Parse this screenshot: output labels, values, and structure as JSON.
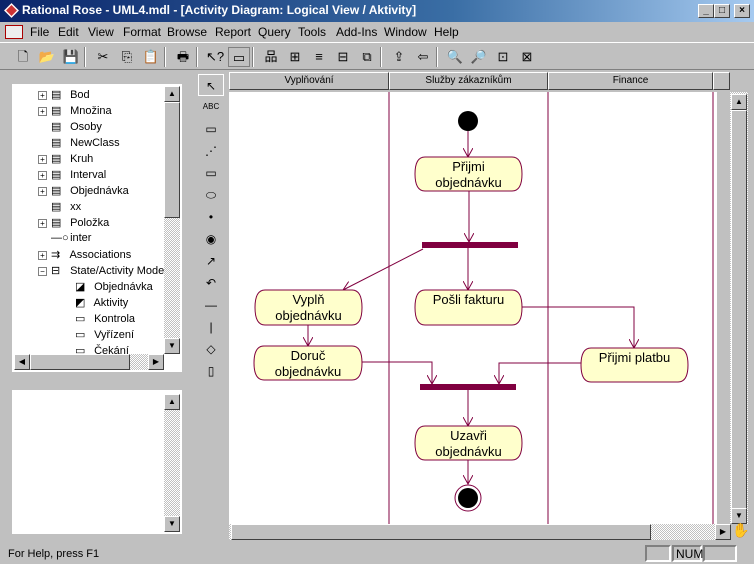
{
  "title": "Rational Rose - UML4.mdl - [Activity Diagram: Logical View / Aktivity]",
  "menu": [
    "File",
    "Edit",
    "View",
    "Format",
    "Browse",
    "Report",
    "Query",
    "Tools",
    "Add-Ins",
    "Window",
    "Help"
  ],
  "toolbar": [
    "new-icon",
    "open-icon",
    "save-icon",
    "cut-icon",
    "copy-icon",
    "paste-icon",
    "print-icon",
    "context-help-icon",
    "view-doc-icon",
    "class-diagram-icon",
    "component-diagram-icon",
    "sequence-icon",
    "collaboration-icon",
    "deployment-icon",
    "browse-parent-icon",
    "previous-diagram-icon",
    "zoom-in-icon",
    "zoom-out-icon",
    "fit-icon",
    "undo-fit-icon"
  ],
  "tree": [
    {
      "label": "Bod",
      "expand": "+",
      "icon": "class"
    },
    {
      "label": "Množina",
      "expand": "+",
      "icon": "param-class"
    },
    {
      "label": "Osoby",
      "expand": "",
      "icon": "class"
    },
    {
      "label": "NewClass",
      "expand": "",
      "icon": "class"
    },
    {
      "label": "Kruh",
      "expand": "+",
      "icon": "class"
    },
    {
      "label": "Interval",
      "expand": "+",
      "icon": "class"
    },
    {
      "label": "Objednávka",
      "expand": "+",
      "icon": "class"
    },
    {
      "label": "xx",
      "expand": "",
      "icon": "class"
    },
    {
      "label": "Položka",
      "expand": "+",
      "icon": "class"
    },
    {
      "label": "inter",
      "expand": "",
      "icon": "interface"
    },
    {
      "label": "Associations",
      "expand": "+",
      "icon": "associations"
    },
    {
      "label": "State/Activity Mode",
      "expand": "-",
      "icon": "state-model"
    },
    {
      "label": "Objednávka",
      "expand": "",
      "icon": "statechart",
      "indent": 1
    },
    {
      "label": "Aktivity",
      "expand": "",
      "icon": "activity-diagram",
      "indent": 1
    },
    {
      "label": "Kontrola",
      "expand": "",
      "icon": "activity",
      "indent": 1
    },
    {
      "label": "Vyřízení",
      "expand": "",
      "icon": "activity",
      "indent": 1
    },
    {
      "label": "Čekání",
      "expand": "",
      "icon": "activity",
      "indent": 1
    }
  ],
  "palette": [
    "selection-arrow",
    "ABC",
    "note",
    "anchor",
    "state",
    "activity",
    "start",
    "end",
    "transition",
    "self-transition",
    "horizontal-sync",
    "vertical-sync",
    "decision",
    "swimlane"
  ],
  "swimlanes": [
    "Vyplňování",
    "Služby zákazníkům",
    "Finance"
  ],
  "activities": {
    "prijmi": [
      "Přijmi",
      "objednávku"
    ],
    "vypln": [
      "Vyplň",
      "objednávku"
    ],
    "posli": [
      "Pošli fakturu"
    ],
    "doruc": [
      "Doruč",
      "objednávku"
    ],
    "platbu": [
      "Přijmi platbu"
    ],
    "uzavri": [
      "Uzavři",
      "objednávku"
    ]
  },
  "colors": {
    "line": "#800040",
    "fill": "#ffffcc",
    "title": "#0a246a"
  },
  "status": {
    "help": "For Help, press F1",
    "num": "NUM"
  }
}
